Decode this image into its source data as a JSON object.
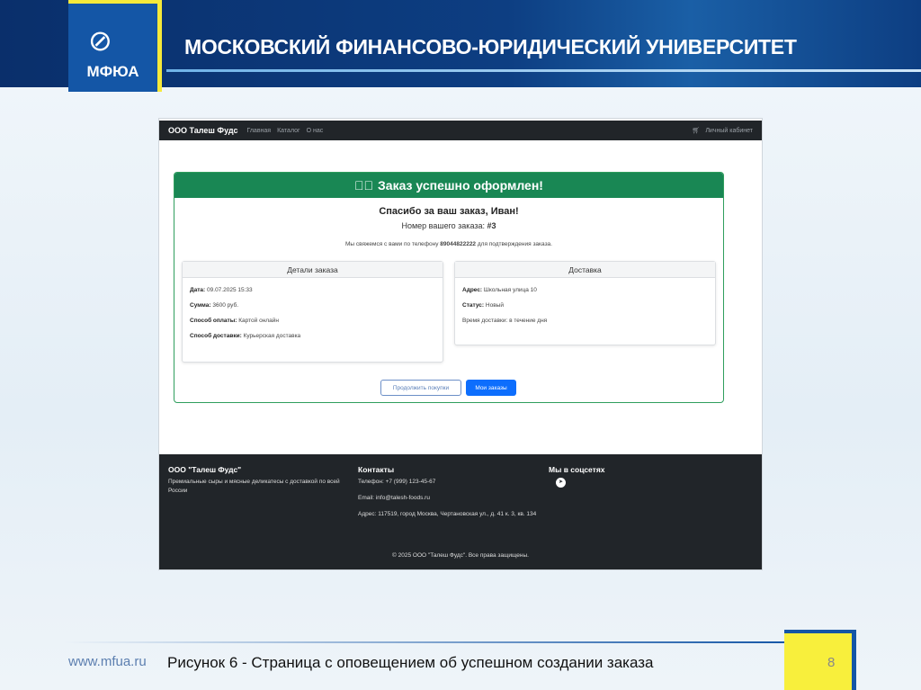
{
  "slide": {
    "logo_text": "МФЮА",
    "university": "МОСКОВСКИЙ ФИНАНСОВО-ЮРИДИЧЕСКИЙ УНИВЕРСИТЕТ",
    "url": "www.mfua.ru",
    "caption": "Рисунок 6 - Страница с оповещением об успешном создании заказа",
    "page_number": "8"
  },
  "nav": {
    "brand": "ООО Талеш Фудс",
    "links": [
      "Главная",
      "Каталог",
      "О нас"
    ],
    "account": "Личный кабинет"
  },
  "order": {
    "header": "Заказ успешно оформлен!",
    "thanks": "Спасибо за ваш заказ, Иван!",
    "number_label": "Номер вашего заказа:",
    "number": "#3",
    "contact_pre": "Мы свяжемся с вами по телефону",
    "phone": "89044822222",
    "contact_post": "для подтверждения заказа."
  },
  "details": {
    "title": "Детали заказа",
    "rows": [
      {
        "k": "Дата:",
        "v": "09.07.2025 15:33"
      },
      {
        "k": "Сумма:",
        "v": "3600 руб."
      },
      {
        "k": "Способ оплаты:",
        "v": "Картой онлайн"
      },
      {
        "k": "Способ доставки:",
        "v": "Курьерская доставка"
      }
    ]
  },
  "delivery": {
    "title": "Доставка",
    "rows": [
      {
        "k": "Адрес:",
        "v": "Школьная улица 10"
      },
      {
        "k": "Статус:",
        "v": "Новый"
      }
    ],
    "time": "Время доставки: в течение дня"
  },
  "buttons": {
    "continue": "Продолжить покупки",
    "orders": "Мои заказы"
  },
  "footer": {
    "company": "ООО \"Талеш Фудс\"",
    "desc": "Премиальные сыры и мясные деликатесы с доставкой по всей России",
    "contacts_title": "Контакты",
    "phone": "Телефон: +7 (999) 123-45-67",
    "email": "Email: info@talesh-foods.ru",
    "address": "Адрес: 117519, город Москва, Чертановская ул., д. 41 к. 3, кв. 134",
    "social_title": "Мы в соцсетях",
    "copyright": "© 2025 ООО \"Талеш Фудс\". Все права защищены."
  }
}
